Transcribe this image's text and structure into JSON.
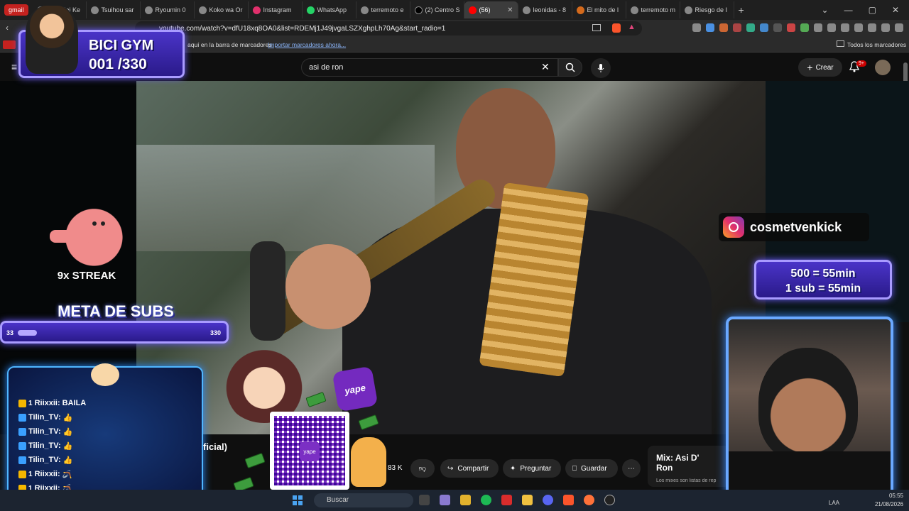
{
  "browser": {
    "gmail_chip": "gmail",
    "tabs": [
      {
        "label": "Rakudai Ke"
      },
      {
        "label": "Tsuihou sar"
      },
      {
        "label": "Ryoumin 0"
      },
      {
        "label": "Koko wa Or"
      },
      {
        "label": "Instagram"
      },
      {
        "label": "WhatsApp"
      },
      {
        "label": "terremoto e"
      },
      {
        "label": "(2) Centro S"
      },
      {
        "label": "(56)",
        "active": true
      },
      {
        "label": "leonidas - 8"
      },
      {
        "label": "El mito de l"
      },
      {
        "label": "terremoto m"
      },
      {
        "label": "Riesgo de I"
      }
    ],
    "url": "youtube.com/watch?v=dfU18xq8OA0&list=RDEMj1J49jvgaLSZXghpLh70Ag&start_radio=1",
    "bookmarks_hint": "aquí en la barra de marcadores",
    "bookmarks_import": "Importar marcadores ahora...",
    "all_bookmarks": "Todos los marcadores",
    "accent": "#c5221f"
  },
  "youtube": {
    "search_value": "asi de ron",
    "create_label": "Crear",
    "notif_badge": "9+",
    "title_fragment": "ficial)",
    "like_count": "83 K",
    "share_label": "Compartir",
    "ask_label": "Preguntar",
    "save_label": "Guardar",
    "mix_title": "Mix: Asi D' Ron",
    "mix_subtitle": "Los mixes son listas de rep"
  },
  "overlay": {
    "bici_title": "BICI GYM",
    "bici_count": "001 /330",
    "streak": "9x STREAK",
    "meta_title": "META DE SUBS",
    "meta_current": "33",
    "meta_goal": "330",
    "meta_progress": 0.1,
    "yape_logo": "yape",
    "instagram_handle": "cosmetvenkick",
    "subs_line1": "500 = 55min",
    "subs_line2": "1 sub = 55min",
    "chat": [
      {
        "badge": "gift",
        "num": "1",
        "user": "Riixxii:",
        "msg": "BAILA"
      },
      {
        "badge": "kick",
        "num": "",
        "user": "Tilin_TV:",
        "msg": "👍"
      },
      {
        "badge": "kick",
        "num": "",
        "user": "Tilin_TV:",
        "msg": "👍"
      },
      {
        "badge": "kick",
        "num": "",
        "user": "Tilin_TV:",
        "msg": "👍"
      },
      {
        "badge": "kick",
        "num": "",
        "user": "Tilin_TV:",
        "msg": "👍"
      },
      {
        "badge": "gift",
        "num": "1",
        "user": "Riixxii:",
        "msg": "🪃"
      },
      {
        "badge": "gift",
        "num": "1",
        "user": "Riixxii:",
        "msg": "🪃"
      }
    ]
  },
  "taskbar": {
    "search_placeholder": "Buscar",
    "lang": "LAA",
    "time": "05:55",
    "date": "21/08/2026"
  }
}
